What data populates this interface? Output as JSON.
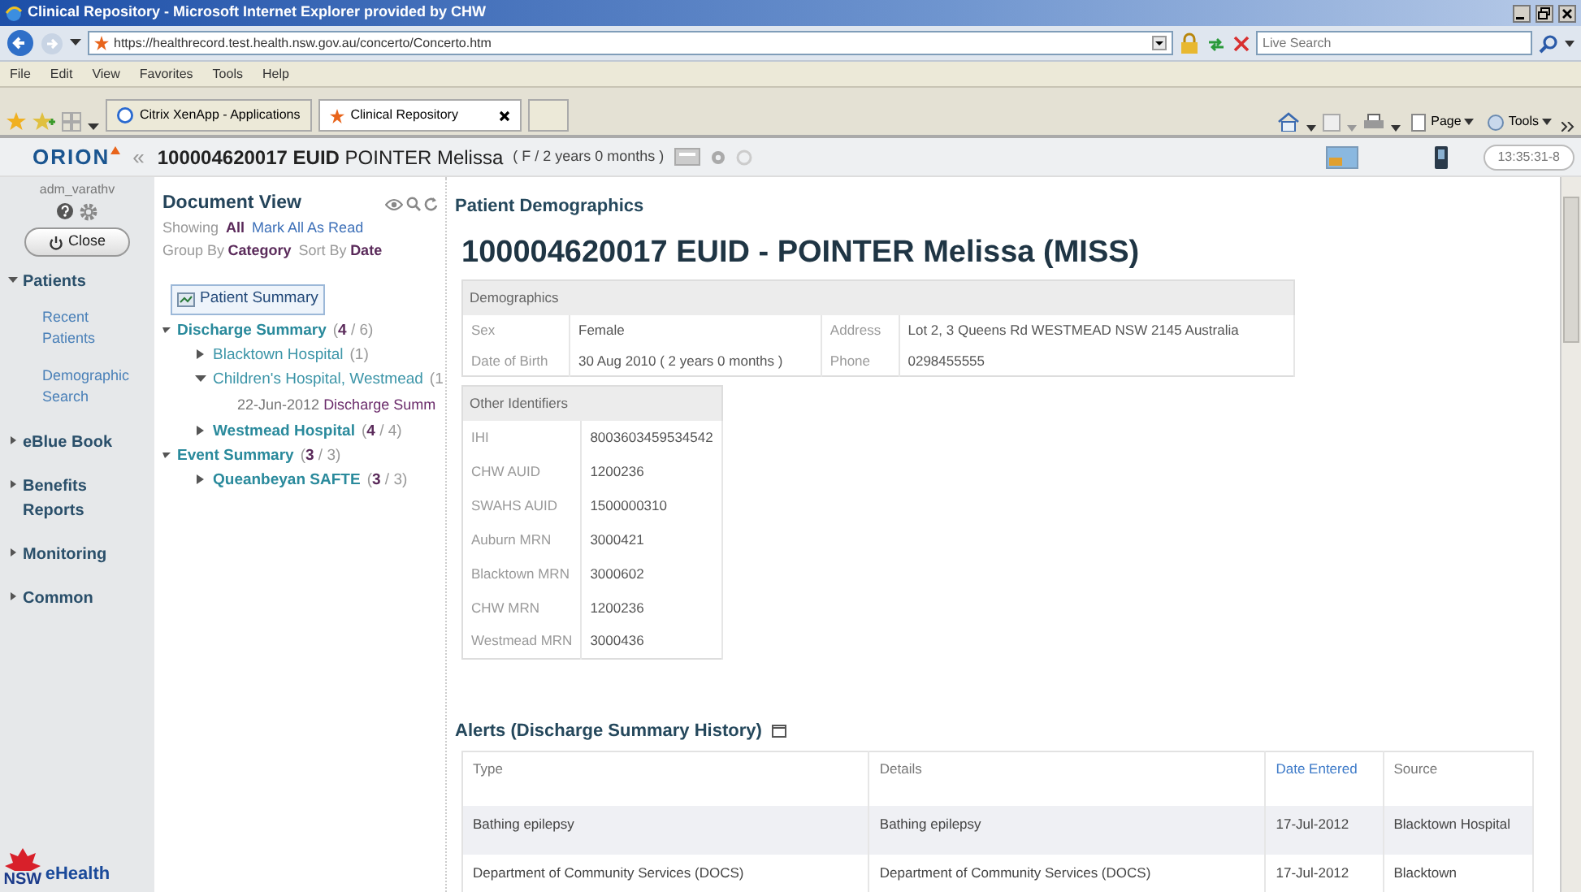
{
  "browser": {
    "title": "Clinical Repository - Microsoft Internet Explorer provided by CHW",
    "address": "https://healthrecord.test.health.nsw.gov.au/concerto/Concerto.htm",
    "search": {
      "placeholder": "Live Search"
    },
    "menu": [
      "File",
      "Edit",
      "View",
      "Favorites",
      "Tools",
      "Help"
    ],
    "tabs": [
      {
        "label": "Citrix XenApp - Applications",
        "selected": false
      },
      {
        "label": "Clinical Repository",
        "selected": true
      }
    ],
    "command_bar": [
      "Page",
      "Tools"
    ]
  },
  "app": {
    "logo": "ORION",
    "collapse": "«",
    "patient_title": "**100004620017 EUID** POINTER Melissa",
    "patient_info": "( F / 2 years 0 months )",
    "time": "13:35:31-8"
  },
  "sidebar": {
    "user": "adm_varathv",
    "close": "Close",
    "items": [
      {
        "label": "Patients",
        "expanded": true,
        "children": [
          {
            "label": "Recent Patients"
          },
          {
            "label": "Demographic Search"
          }
        ]
      },
      {
        "label": "eBlue Book",
        "expanded": false
      },
      {
        "label": "Benefits Reports",
        "expanded": false
      },
      {
        "label": "Monitoring",
        "expanded": false
      },
      {
        "label": "Common",
        "expanded": false
      }
    ],
    "footer": "eHealth",
    "footer_logo": "NSW"
  },
  "document_view": {
    "title": "Document View",
    "showing_label": "Showing",
    "showing": "All",
    "mark_read": "Mark All As Read",
    "group_label": "Group By",
    "group": "Category",
    "sort_label": "Sort By",
    "sort": "Date",
    "summary": {
      "label": "Patient Summary",
      "selected": true
    },
    "tree": [
      {
        "kind": "group",
        "label": "Discharge Summary",
        "count": "(**4** / 6)",
        "unread": true,
        "expanded": true,
        "children": [
          {
            "kind": "group",
            "label": "Blacktown Hospital",
            "count": "(1)",
            "unread": false,
            "expanded": false
          },
          {
            "kind": "group",
            "label": "Children's Hospital, Westmead",
            "count": "(1",
            "unread": false,
            "expanded": true,
            "children": [
              {
                "kind": "document",
                "date": "22-Jun-2012",
                "label": "Discharge Summ"
              }
            ]
          },
          {
            "kind": "group",
            "label": "Westmead Hospital",
            "count": "(**4** / 4)",
            "unread": true,
            "expanded": false
          }
        ]
      },
      {
        "kind": "group",
        "label": "Event Summary",
        "count": "(**3** / 3)",
        "unread": true,
        "expanded": true,
        "children": [
          {
            "kind": "group",
            "label": "Queanbeyan SAFTE",
            "count": "(**3** / 3)",
            "unread": true,
            "expanded": false
          }
        ]
      }
    ]
  },
  "main": {
    "section": "Patient Demographics",
    "heading": "100004620017 EUID - POINTER Melissa  (MISS)",
    "demographics": {
      "title": "Demographics",
      "rows": [
        [
          "Sex",
          "Female",
          "Address",
          "Lot 2, 3 Queens Rd WESTMEAD NSW 2145 Australia"
        ],
        [
          "Date of Birth",
          "30 Aug 2010 ( 2 years 0 months )",
          "Phone",
          "0298455555"
        ]
      ]
    },
    "identifiers": {
      "title": "Other Identifiers",
      "rows": [
        [
          "IHI",
          "8003603459534542"
        ],
        [
          "CHW AUID",
          "1200236"
        ],
        [
          "SWAHS AUID",
          "1500000310"
        ],
        [
          "Auburn MRN",
          "3000421"
        ],
        [
          "Blacktown MRN",
          "3000602"
        ],
        [
          "CHW MRN",
          "1200236"
        ],
        [
          "Westmead MRN",
          "3000436"
        ]
      ]
    },
    "alerts": {
      "title": "Alerts (Discharge Summary History)",
      "columns": [
        {
          "label": "Type",
          "sortable": false
        },
        {
          "label": "Details",
          "sortable": false
        },
        {
          "label": "Date Entered",
          "sortable": true
        },
        {
          "label": "Source",
          "sortable": false
        }
      ],
      "rows": [
        [
          "Bathing epilepsy",
          "Bathing epilepsy",
          "17-Jul-2012",
          "Blacktown Hospital"
        ],
        [
          "Department of Community Services (DOCS)",
          "Department of Community Services (DOCS)",
          "17-Jul-2012",
          "Blacktown"
        ]
      ]
    }
  }
}
